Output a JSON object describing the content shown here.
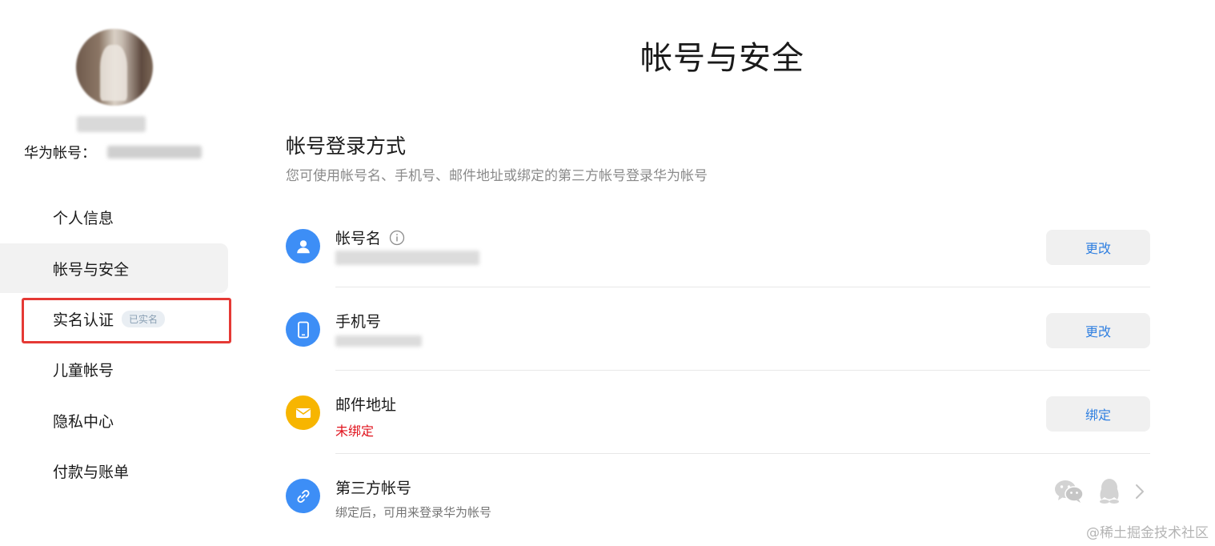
{
  "page": {
    "title": "帐号与安全"
  },
  "sidebar": {
    "account_label": "华为帐号：",
    "items": [
      {
        "label": "个人信息"
      },
      {
        "label": "帐号与安全"
      },
      {
        "label": "实名认证",
        "badge": "已实名"
      },
      {
        "label": "儿童帐号"
      },
      {
        "label": "隐私中心"
      },
      {
        "label": "付款与账单"
      }
    ]
  },
  "section": {
    "title": "帐号登录方式",
    "description": "您可使用帐号名、手机号、邮件地址或绑定的第三方帐号登录华为帐号"
  },
  "rows": [
    {
      "name": "帐号名",
      "button": "更改",
      "icon": "user-icon"
    },
    {
      "name": "手机号",
      "button": "更改",
      "icon": "phone-icon"
    },
    {
      "name": "邮件地址",
      "status": "未绑定",
      "button": "绑定",
      "icon": "mail-icon"
    },
    {
      "name": "第三方帐号",
      "description": "绑定后，可用来登录华为帐号",
      "icon": "link-icon"
    }
  ],
  "colors": {
    "accent_blue": "#3d8ef6",
    "accent_yellow": "#f7b500",
    "link_blue": "#2f7fe0",
    "warning_red": "#e0121c",
    "highlight_red": "#e53935"
  },
  "watermark": "@稀土掘金技术社区"
}
